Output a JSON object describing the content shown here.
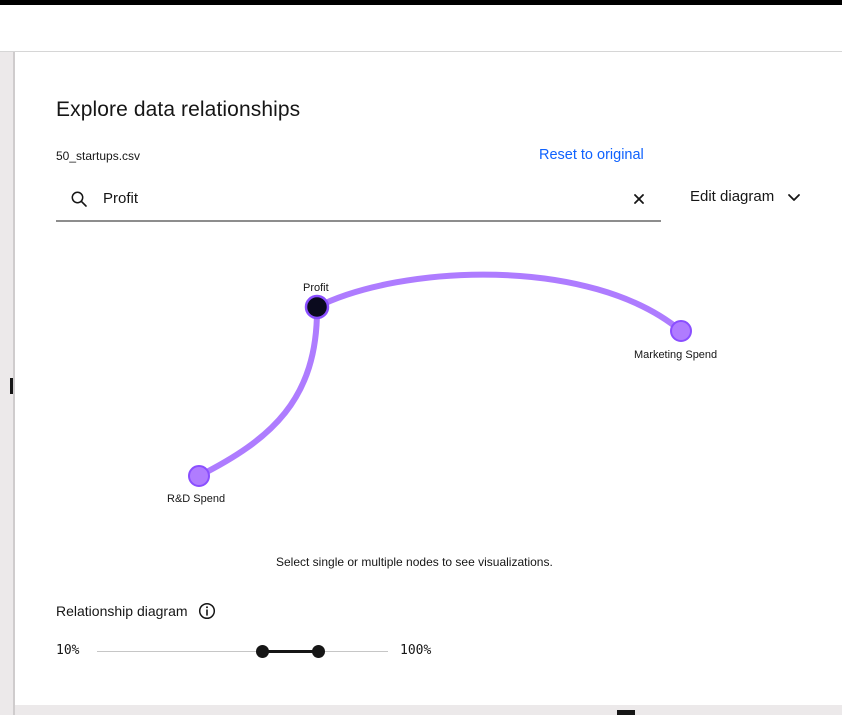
{
  "panel": {
    "title": "Explore data relationships",
    "filename": "50_startups.csv",
    "reset_label": "Reset to original"
  },
  "search": {
    "value": "Profit",
    "icon": "search-icon",
    "clear_icon": "close-icon"
  },
  "edit_diagram": {
    "label": "Edit diagram",
    "icon": "chevron-down-icon"
  },
  "diagram": {
    "nodes": [
      {
        "id": "profit",
        "label": "Profit",
        "selected": true
      },
      {
        "id": "marketing",
        "label": "Marketing Spend",
        "selected": false
      },
      {
        "id": "rd",
        "label": "R&D Spend",
        "selected": false
      }
    ],
    "edges": [
      {
        "from": "profit",
        "to": "marketing"
      },
      {
        "from": "profit",
        "to": "rd"
      }
    ],
    "colors": {
      "edge": "#a56eff",
      "node_fill": "#a56eff",
      "selected_node_fill": "#0a0a1e"
    },
    "hint": "Select single or multiple nodes to see visualizations."
  },
  "relationship": {
    "label": "Relationship diagram",
    "info_icon": "info-icon",
    "min_label": "10%",
    "max_label": "100%"
  },
  "colors": {
    "link": "#0f62fe",
    "text": "#161616"
  }
}
